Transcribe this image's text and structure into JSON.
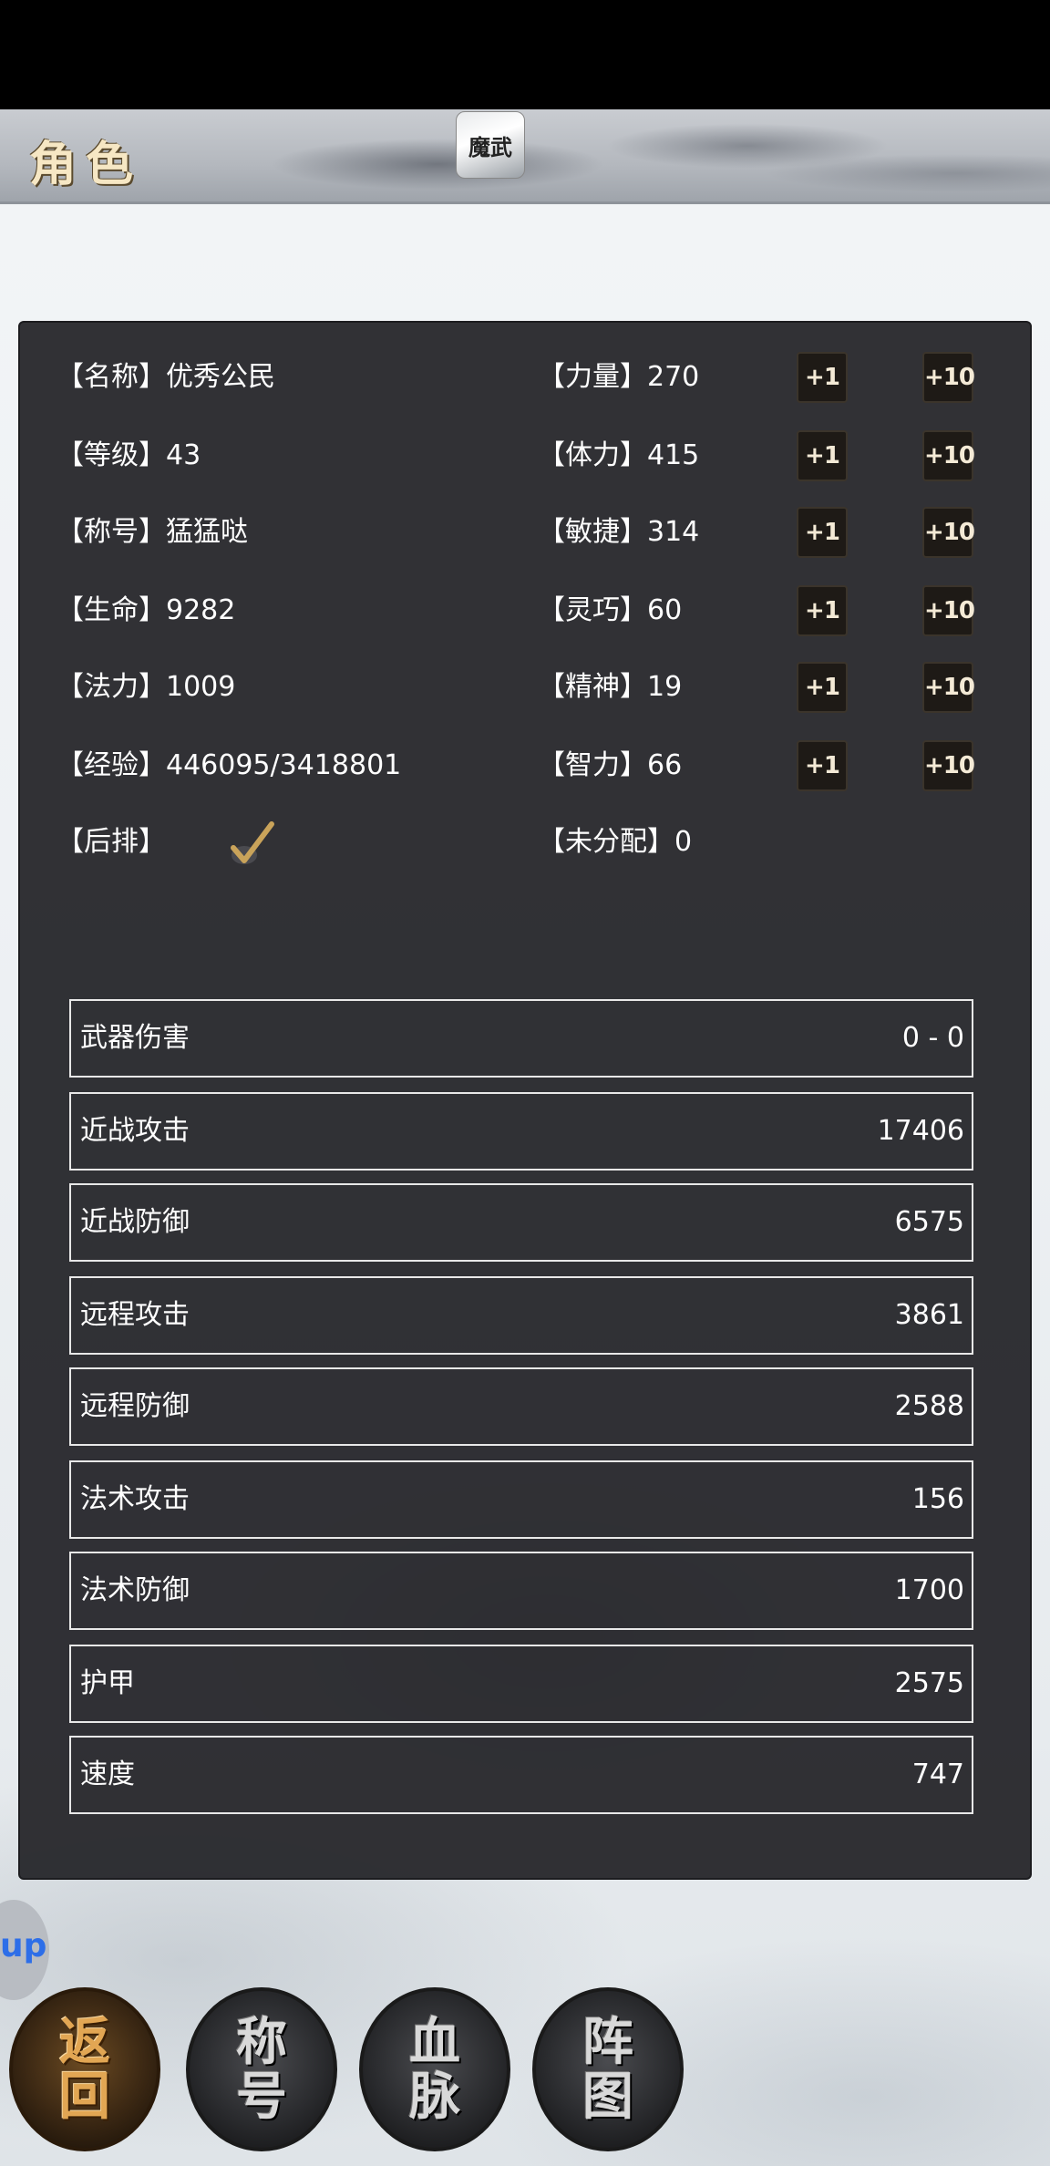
{
  "header": {
    "title": "角色",
    "app_icon_text": "魔武"
  },
  "attributes_left": [
    {
      "label": "【名称】",
      "value": "优秀公民"
    },
    {
      "label": "【等级】",
      "value": "43"
    },
    {
      "label": "【称号】",
      "value": "猛猛哒"
    },
    {
      "label": "【生命】",
      "value": "9282"
    },
    {
      "label": "【法力】",
      "value": "1009"
    },
    {
      "label": "【经验】",
      "value": "446095/3418801"
    },
    {
      "label": "【后排】",
      "value": ""
    }
  ],
  "attributes_right": [
    {
      "label": "【力量】",
      "value": "270"
    },
    {
      "label": "【体力】",
      "value": "415"
    },
    {
      "label": "【敏捷】",
      "value": "314"
    },
    {
      "label": "【灵巧】",
      "value": "60"
    },
    {
      "label": "【精神】",
      "value": "19"
    },
    {
      "label": "【智力】",
      "value": "66"
    },
    {
      "label": "【未分配】",
      "value": "0"
    }
  ],
  "buttons": {
    "plus1": "+1",
    "plus10": "+10"
  },
  "stats": [
    {
      "label": "武器伤害",
      "value": "0 - 0"
    },
    {
      "label": "近战攻击",
      "value": "17406"
    },
    {
      "label": "近战防御",
      "value": "6575"
    },
    {
      "label": "远程攻击",
      "value": "3861"
    },
    {
      "label": "远程防御",
      "value": "2588"
    },
    {
      "label": "法术攻击",
      "value": "156"
    },
    {
      "label": "法术防御",
      "value": "1700"
    },
    {
      "label": "护甲",
      "value": "2575"
    },
    {
      "label": "速度",
      "value": "747"
    }
  ],
  "side_tab": {
    "text": "up"
  },
  "nav": [
    {
      "label": "返回"
    },
    {
      "label": "称号"
    },
    {
      "label": "血脉"
    },
    {
      "label": "阵图"
    }
  ],
  "colors": {
    "panel_bg": "#26262a",
    "check_gold": "#c9a35a",
    "active_nav": "#e2a653"
  },
  "icons": {
    "back_row_check": "checkmark-icon"
  }
}
